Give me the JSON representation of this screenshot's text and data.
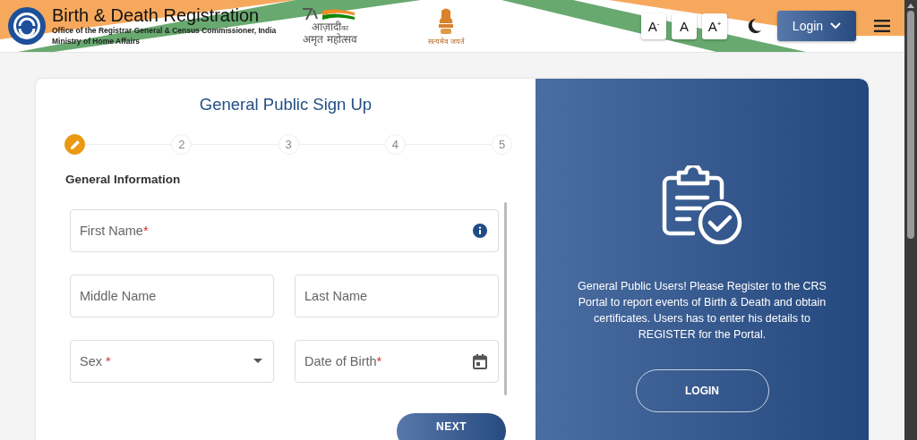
{
  "header": {
    "title": "Birth & Death Registration",
    "subtitle": "Office of the Registrar General & Census Commissioner, India",
    "ministry": "Ministry of Home Affairs",
    "azadi_line1": "आज़ादी",
    "azadi_ka": "का",
    "azadi_line2": "अमृत महोत्सव",
    "emblem_motto": "सत्यमेव जयते",
    "font_buttons": [
      {
        "text": "A$^{-}$"
      },
      {
        "text": "A"
      },
      {
        "text": "A$^{+}$"
      }
    ],
    "login_button": "Login"
  },
  "form": {
    "title": "General Public Sign Up",
    "steps": [
      {
        "kind": "edit",
        "selected": true
      },
      {
        "label": "2",
        "selected": false
      },
      {
        "label": "3",
        "selected": false
      },
      {
        "label": "4",
        "selected": false
      },
      {
        "label": "5",
        "selected": false
      }
    ],
    "section": "General Information",
    "rows": [
      [
        {
          "kind": "info",
          "placeholder": "First Name",
          "required_mark": "*"
        }
      ],
      [
        {
          "kind": "text",
          "placeholder": "Middle Name"
        },
        {
          "kind": "text",
          "placeholder": "Last Name"
        }
      ],
      [
        {
          "kind": "select",
          "placeholder": "Sex",
          "required_mark": "*"
        },
        {
          "kind": "date",
          "placeholder": "Date of Birth",
          "required_mark": "*"
        }
      ]
    ],
    "next_button": "NEXT"
  },
  "info_panel": {
    "message": "General Public Users! Please Register to the CRS Portal to report events of Birth & Death and obtain certificates. Users has to enter his details to REGISTER for the Portal.",
    "login_button": "LOGIN"
  }
}
